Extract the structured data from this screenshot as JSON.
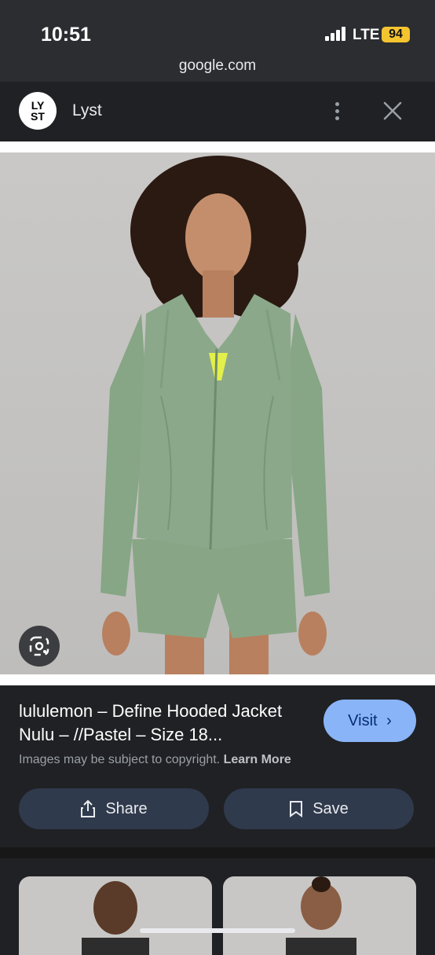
{
  "status": {
    "time": "10:51",
    "network": "LTE",
    "battery": "94"
  },
  "browser": {
    "url": "google.com"
  },
  "site": {
    "logo_text_line1": "LY",
    "logo_text_line2": "ST",
    "name": "Lyst"
  },
  "result": {
    "title": "lululemon – Define Hooded Jacket Nulu – //Pastel – Size 18...",
    "visit_label": "Visit",
    "copyright_text": "Images may be subject to copyright.",
    "learn_more": "Learn More",
    "share_label": "Share",
    "save_label": "Save"
  },
  "colors": {
    "accent": "#8ab4f8",
    "jacket": "#8ba98a",
    "background": "#202124"
  }
}
